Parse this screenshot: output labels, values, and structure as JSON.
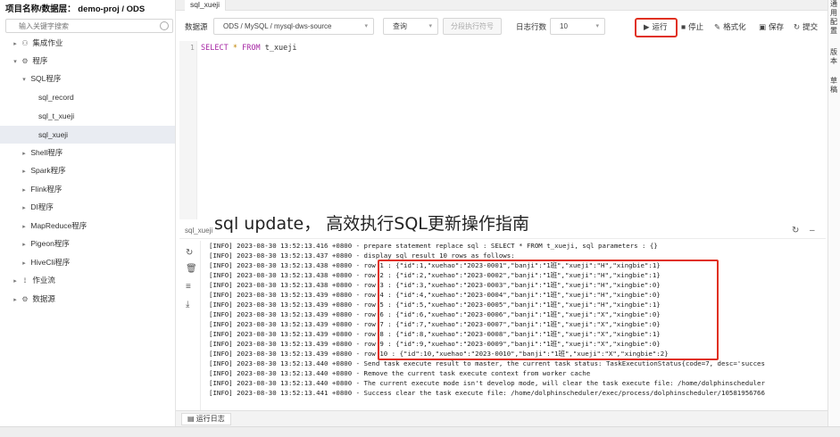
{
  "sidebar": {
    "title": "项目名称/数据层： demo-proj / ODS",
    "search_placeholder": "输入关键字搜索",
    "items": [
      {
        "label": "集成作业",
        "caret": "▸",
        "icon": "⚇"
      },
      {
        "label": "程序",
        "caret": "▾",
        "icon": "⚙"
      },
      {
        "label": "SQL程序",
        "caret": "▾",
        "icon": ""
      },
      {
        "label": "sql_record",
        "caret": "",
        "icon": ""
      },
      {
        "label": "sql_t_xueji",
        "caret": "",
        "icon": ""
      },
      {
        "label": "sql_xueji",
        "caret": "",
        "icon": ""
      },
      {
        "label": "Shell程序",
        "caret": "▸",
        "icon": ""
      },
      {
        "label": "Spark程序",
        "caret": "▸",
        "icon": ""
      },
      {
        "label": "Flink程序",
        "caret": "▸",
        "icon": ""
      },
      {
        "label": "DI程序",
        "caret": "▸",
        "icon": ""
      },
      {
        "label": "MapReduce程序",
        "caret": "▸",
        "icon": ""
      },
      {
        "label": "Pigeon程序",
        "caret": "▸",
        "icon": ""
      },
      {
        "label": "HiveCli程序",
        "caret": "▸",
        "icon": ""
      },
      {
        "label": "作业流",
        "caret": "▸",
        "icon": "⟟"
      },
      {
        "label": "数据源",
        "caret": "▸",
        "icon": "⚙"
      }
    ]
  },
  "tabbar": {
    "active_tab": "sql_xueji"
  },
  "toolbar": {
    "datasource_label": "数据源",
    "datasource_value": "ODS / MySQL / mysql-dws-source",
    "mode_value": "查询",
    "split_button": "分段执行符号",
    "log_rows_label": "日志行数",
    "log_rows_value": "10",
    "run": "运行",
    "stop": "停止",
    "format": "格式化",
    "save": "保存",
    "submit": "提交"
  },
  "right_panel": {
    "chars": [
      "通",
      "用",
      "配",
      "置",
      "版",
      "本",
      "草",
      "稿"
    ]
  },
  "editor": {
    "line_number": "1",
    "kw_select": "SELECT",
    "star": "*",
    "kw_from": "FROM",
    "table": "t_xueji"
  },
  "overlay": {
    "caption": "sql update， 高效执行SQL更新操作指南"
  },
  "log": {
    "tab_label": "sql_xueji",
    "lines": [
      "[INFO] 2023-08-30 13:52:13.416 +0800 - prepare statement replace sql : SELECT * FROM t_xueji, sql parameters : {}",
      "[INFO] 2023-08-30 13:52:13.437 +0800 - display sql result 10 rows as follows:",
      "[INFO] 2023-08-30 13:52:13.438 +0800 - row 1 : {\"id\":1,\"xuehao\":\"2023-0001\",\"banji\":\"1班\",\"xueji\":\"H\",\"xingbie\":1}",
      "[INFO] 2023-08-30 13:52:13.438 +0800 - row 2 : {\"id\":2,\"xuehao\":\"2023-0002\",\"banji\":\"1班\",\"xueji\":\"H\",\"xingbie\":1}",
      "[INFO] 2023-08-30 13:52:13.438 +0800 - row 3 : {\"id\":3,\"xuehao\":\"2023-0003\",\"banji\":\"1班\",\"xueji\":\"H\",\"xingbie\":0}",
      "[INFO] 2023-08-30 13:52:13.439 +0800 - row 4 : {\"id\":4,\"xuehao\":\"2023-0004\",\"banji\":\"1班\",\"xueji\":\"H\",\"xingbie\":0}",
      "[INFO] 2023-08-30 13:52:13.439 +0800 - row 5 : {\"id\":5,\"xuehao\":\"2023-0005\",\"banji\":\"1班\",\"xueji\":\"H\",\"xingbie\":1}",
      "[INFO] 2023-08-30 13:52:13.439 +0800 - row 6 : {\"id\":6,\"xuehao\":\"2023-0006\",\"banji\":\"1班\",\"xueji\":\"X\",\"xingbie\":0}",
      "[INFO] 2023-08-30 13:52:13.439 +0800 - row 7 : {\"id\":7,\"xuehao\":\"2023-0007\",\"banji\":\"1班\",\"xueji\":\"X\",\"xingbie\":0}",
      "[INFO] 2023-08-30 13:52:13.439 +0800 - row 8 : {\"id\":8,\"xuehao\":\"2023-0008\",\"banji\":\"1班\",\"xueji\":\"X\",\"xingbie\":1}",
      "[INFO] 2023-08-30 13:52:13.439 +0800 - row 9 : {\"id\":9,\"xuehao\":\"2023-0009\",\"banji\":\"1班\",\"xueji\":\"X\",\"xingbie\":0}",
      "[INFO] 2023-08-30 13:52:13.439 +0800 - row 10 : {\"id\":10,\"xuehao\":\"2023-0010\",\"banji\":\"1班\",\"xueji\":\"X\",\"xingbie\":2}",
      "[INFO] 2023-08-30 13:52:13.440 +0800 - Send task execute result to master, the current task status: TaskExecutionStatus{code=7, desc='succes",
      "[INFO] 2023-08-30 13:52:13.440 +0800 - Remove the current task execute context from worker cache",
      "[INFO] 2023-08-30 13:52:13.440 +0800 - The current execute mode isn't develop mode, will clear the task execute file: /home/dolphinscheduler",
      "[INFO] 2023-08-30 13:52:13.441 +0800 - Success clear the task execute file: /home/dolphinscheduler/exec/process/dolphinscheduler/10581956766"
    ]
  },
  "bottom": {
    "tab_label": "运行日志"
  },
  "colors": {
    "highlight": "#e0301e",
    "keyword": "#a626a4",
    "selected_row": "#e9ecf2"
  }
}
